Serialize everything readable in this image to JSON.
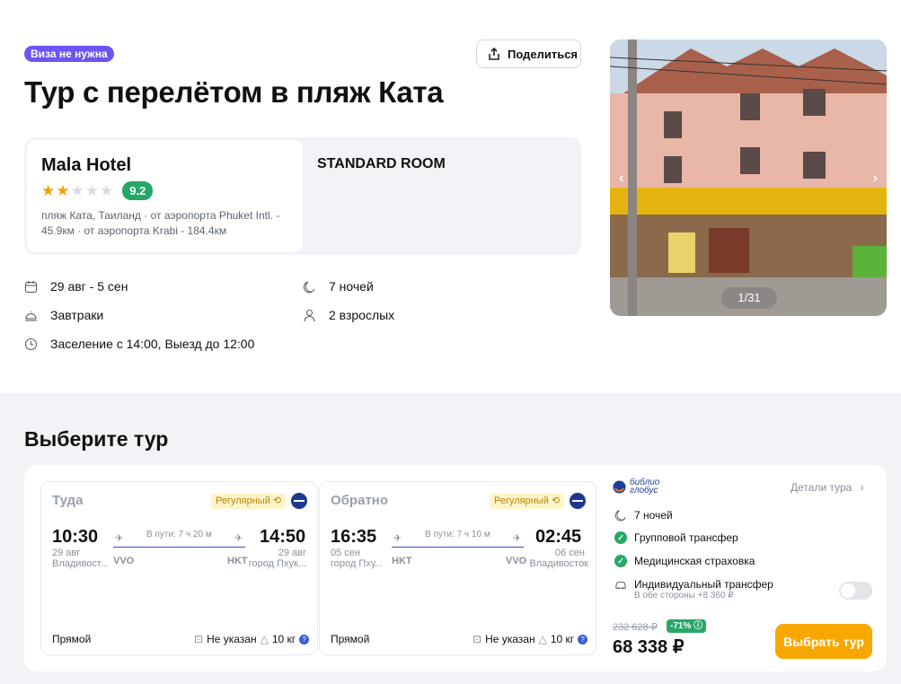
{
  "header": {
    "visa_badge": "Виза не нужна",
    "share_label": "Поделиться",
    "title": "Тур с перелётом в пляж Ката"
  },
  "hotel": {
    "name": "Mala Hotel",
    "stars": 2,
    "max_stars": 5,
    "rating": "9.2",
    "location": "пляж Ката, Таиланд · от аэропорта Phuket Intl. - 45.9км · от аэропорта Krabi - 184.4км",
    "room": "STANDARD ROOM"
  },
  "info": {
    "dates": "29 авг - 5 сен",
    "nights": "7 ночей",
    "meals": "Завтраки",
    "guests": "2 взрослых",
    "checkin": "Заселение с 14:00, Выезд до 12:00"
  },
  "photo": {
    "counter": "1/31",
    "prev": "‹",
    "next": "›"
  },
  "tour_section": {
    "title": "Выберите тур"
  },
  "flights": [
    {
      "label": "Туда",
      "badge": "Регулярный",
      "dep_time": "10:30",
      "dep_date": "29 авг",
      "dep_city": "Владивост...",
      "dep_code": "VVO",
      "duration": "В пути: 7 ч 20 м",
      "arr_time": "14:50",
      "arr_date": "29 авг",
      "arr_city": "город Пхук...",
      "arr_code": "HKT",
      "type": "Прямой",
      "hand_luggage": "Не указан",
      "baggage": "10 кг"
    },
    {
      "label": "Обратно",
      "badge": "Регулярный",
      "dep_time": "16:35",
      "dep_date": "05 сен",
      "dep_city": "город Пху...",
      "dep_code": "HKT",
      "duration": "В пути: 7 ч 10 м",
      "arr_time": "02:45",
      "arr_date": "06 сен",
      "arr_city": "Владивосток",
      "arr_code": "VVO",
      "type": "Прямой",
      "hand_luggage": "Не указан",
      "baggage": "10 кг"
    }
  ],
  "offer": {
    "operator_line1": "библио",
    "operator_line2": "глобус",
    "details": "Детали тура",
    "nights": "7 ночей",
    "transfer": "Групповой трансфер",
    "insurance": "Медицинская страховка",
    "individual_transfer": "Индивидуальный трансфер",
    "individual_transfer_note": "В обе стороны +8 360 ₽",
    "old_price": "232 628 ₽",
    "discount": "-71%",
    "price": "68 338 ₽",
    "choose_label": "Выбрать тур"
  }
}
